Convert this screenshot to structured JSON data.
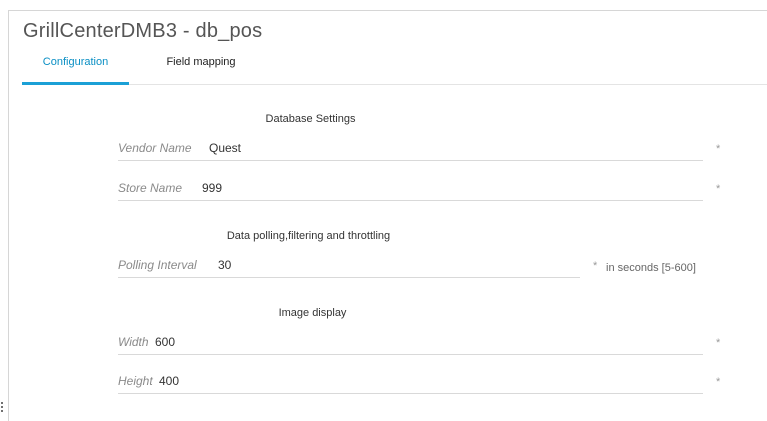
{
  "window": {
    "title": "GrillCenterDMB3 - db_pos"
  },
  "tabs": [
    {
      "label": "Configuration",
      "active": true
    },
    {
      "label": "Field mapping",
      "active": false
    }
  ],
  "sections": {
    "database": {
      "heading": "Database Settings",
      "vendor": {
        "label": "Vendor Name",
        "value": "Quest",
        "required_mark": "*"
      },
      "store": {
        "label": "Store Name",
        "value": "999",
        "required_mark": "*"
      }
    },
    "polling": {
      "heading": "Data polling,filtering and throttling",
      "interval": {
        "label": "Polling Interval",
        "value": "30",
        "required_mark": "*",
        "hint": "in seconds [5-600]"
      }
    },
    "image": {
      "heading": "Image display",
      "width": {
        "label": "Width",
        "value": "600",
        "required_mark": "*"
      },
      "height": {
        "label": "Height",
        "value": "400",
        "required_mark": "*"
      }
    }
  },
  "colors": {
    "accent": "#1ba0d6",
    "active_tab_text": "#0a8fc4"
  }
}
